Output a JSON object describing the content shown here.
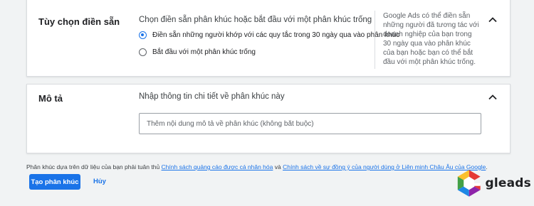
{
  "prefill_section": {
    "title": "Tùy chọn điền sẵn",
    "prompt": "Chọn điền sẵn phân khúc hoặc bắt đầu với một phân khúc trống",
    "options": [
      {
        "label": "Điền sẵn những người khớp với các quy tắc trong 30 ngày qua vào phân khúc",
        "selected": true
      },
      {
        "label": "Bắt đầu với một phân khúc trống",
        "selected": false
      }
    ],
    "help_text": "Google Ads có thể điền sẵn những người đã tương tác với doanh nghiệp của bạn trong 30 ngày qua vào phân khúc của bạn hoặc bạn có thể bắt đầu với một phân khúc trống.",
    "collapse_icon": "chevron-up-icon"
  },
  "description_section": {
    "title": "Mô tả",
    "prompt": "Nhập thông tin chi tiết về phân khúc này",
    "input": {
      "value": "",
      "placeholder": "Thêm nội dung mô tả về phân khúc (không bắt buộc)"
    },
    "collapse_icon": "chevron-up-icon"
  },
  "footer": {
    "note_prefix": "Phân khúc dựa trên dữ liệu của bạn phải tuân thủ ",
    "link1": "Chính sách quảng cáo được cá nhân hóa",
    "note_middle": " và ",
    "link2": "Chính sách về sự đồng ý của người dùng ở Liên minh Châu Âu của Google",
    "note_suffix": "."
  },
  "actions": {
    "create_label": "Tạo phân khúc",
    "cancel_label": "Hủy"
  },
  "watermark": {
    "text": "gleads",
    "logo_icon": "gleads-logo-icon"
  },
  "colors": {
    "accent": "#1a73e8",
    "background": "#f1f3f4",
    "card": "#ffffff",
    "border": "#dadce0"
  }
}
